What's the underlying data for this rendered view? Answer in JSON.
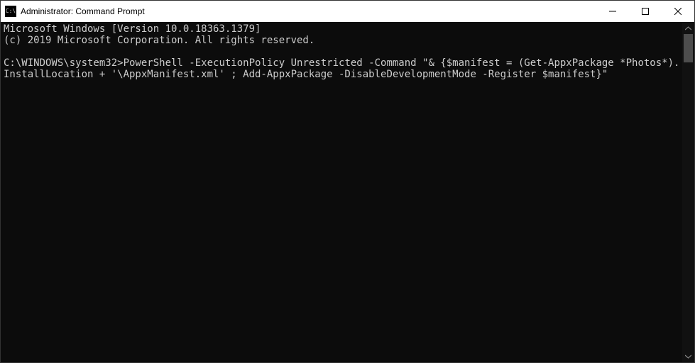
{
  "titlebar": {
    "icon_label": "C:\\",
    "title": "Administrator: Command Prompt"
  },
  "window_controls": {
    "minimize": "Minimize",
    "maximize": "Maximize",
    "close": "Close"
  },
  "terminal": {
    "banner_line1": "Microsoft Windows [Version 10.0.18363.1379]",
    "banner_line2": "(c) 2019 Microsoft Corporation. All rights reserved.",
    "prompt_path": "C:\\WINDOWS\\system32>",
    "command": "PowerShell -ExecutionPolicy Unrestricted -Command \"& {$manifest = (Get-AppxPackage *Photos*).InstallLocation + '\\AppxManifest.xml' ; Add-AppxPackage -DisableDevelopmentMode -Register $manifest}\""
  },
  "scrollbar": {
    "up": "Scroll up",
    "down": "Scroll down"
  }
}
